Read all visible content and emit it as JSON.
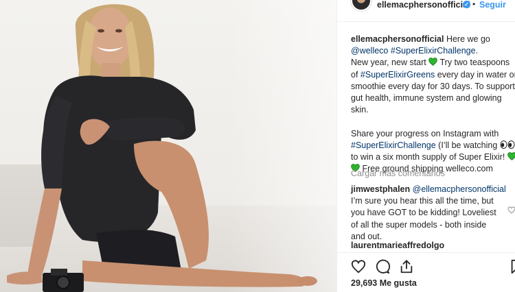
{
  "header": {
    "username": "ellemacphersonofficial",
    "separator": "•",
    "follow_label": "Seguir"
  },
  "caption": {
    "username": "ellemacphersonofficial",
    "l1": "Here we go",
    "l2_tag1": "@welleco",
    "l2_tag2": "#SuperElixirChallenge",
    "l2_end": ".",
    "l3": "New year, new start",
    "l3_end": " Try two teaspoons",
    "l4_pre": "of ",
    "l4_tag": "#SuperElixirGreens",
    "l4_post": " every day in water or a",
    "l5": "smoothie every day for 30 days. To support",
    "l6": "gut health, immune system and glowing",
    "l7": "skin.",
    "l8": "Share your progress on Instagram with",
    "l9_tag": "#SuperElixirChallenge",
    "l9_post": " (I’ll be watching ",
    "l9_end": ")",
    "l10": "to win a six month supply of Super Elixir!",
    "l11": " Free ground shipping welleco.com"
  },
  "load_more_label": "Cargar más comentarios",
  "comment1": {
    "username": "jimwestphalen",
    "mention": "@ellemacphersonofficial",
    "l1": "I’m sure you hear this all the time, but",
    "l2": "you have GOT to be kidding! Loveliest",
    "l3": "of all the super models - both inside",
    "l4": "and out."
  },
  "comment2": {
    "username": "laurentmarieaffredolgo"
  },
  "likes_text": "29,693 Me gusta",
  "icons": [
    "heart-icon",
    "comment-icon",
    "share-icon",
    "bookmark-icon",
    "verified-badge-icon",
    "green-heart-emoji",
    "eyes-emoji"
  ],
  "colors": {
    "link_blue": "#3897f0",
    "hashtag": "#003569",
    "text": "#262626",
    "muted": "#8e8e8e",
    "green_heart": "#2fb52f"
  }
}
